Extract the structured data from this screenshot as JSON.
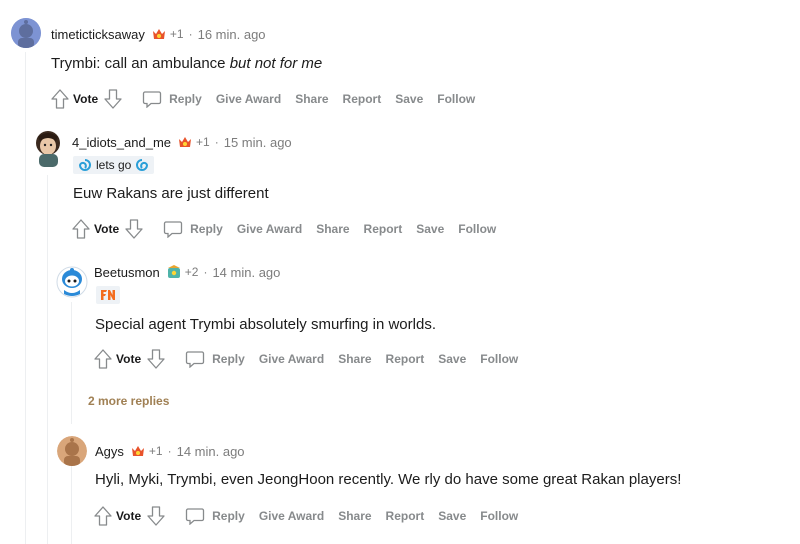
{
  "vote_label": "Vote",
  "actions": {
    "reply": "Reply",
    "give_award": "Give Award",
    "share": "Share",
    "report": "Report",
    "save": "Save",
    "follow": "Follow"
  },
  "comments": [
    {
      "username": "timeticticksaway",
      "award_count": "+1",
      "separator": "·",
      "time": "16 min. ago",
      "body_plain": "Trymbi: call an ambulance ",
      "body_italic": "but not for me"
    },
    {
      "username": "4_idiots_and_me",
      "award_count": "+1",
      "separator": "·",
      "time": "15 min. ago",
      "flair": "lets go",
      "body_plain": "Euw Rakans are just different"
    },
    {
      "username": "Beetusmon",
      "award_count": "+2",
      "separator": "·",
      "time": "14 min. ago",
      "flair_icon": "fnatic-logo",
      "body_plain": "Special agent Trymbi absolutely smurfing in worlds."
    },
    {
      "username": "Agys",
      "award_count": "+1",
      "separator": "·",
      "time": "14 min. ago",
      "body_plain": "Hyli, Myki, Trymbi, even JeongHoon recently. We rly do have some great Rakan players!"
    }
  ],
  "more_replies": "2 more replies",
  "colors": {
    "award": "#e8532b",
    "more_replies": "#a08054",
    "meta_gray": "#7c7c7c",
    "action_gray": "#878a8c"
  }
}
